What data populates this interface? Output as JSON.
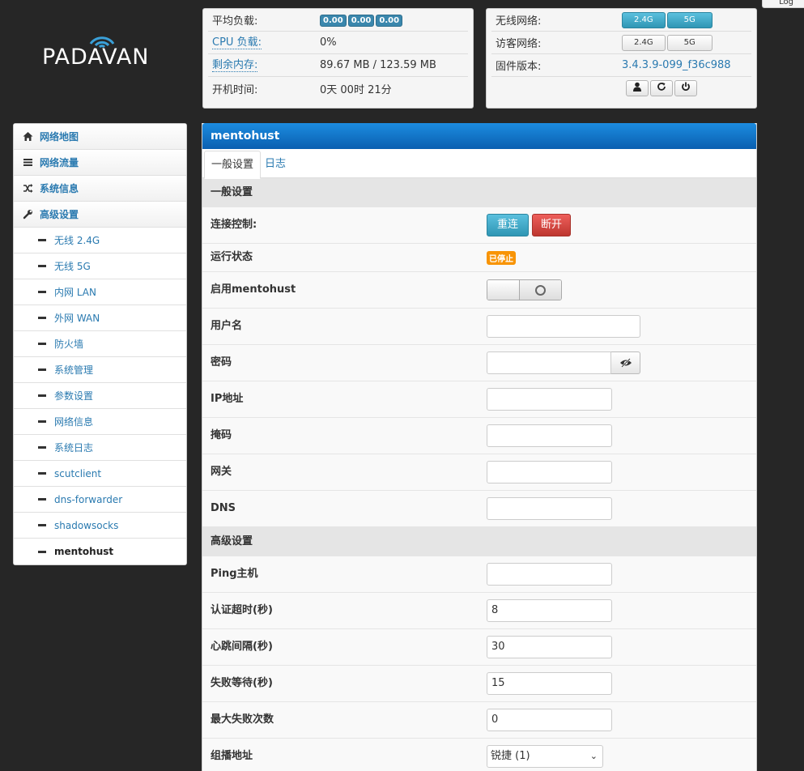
{
  "log_tab": "Log",
  "logo": {
    "text": "PADAVAN"
  },
  "status": {
    "load_label": "平均负载:",
    "load_values": [
      "0.00",
      "0.00",
      "0.00"
    ],
    "cpu_label": "CPU 负载:",
    "cpu_value": "0%",
    "mem_label": "剩余内存:",
    "mem_value": "89.67 MB / 123.59 MB",
    "uptime_label": "开机时间:",
    "uptime_value": "0天 00时 21分"
  },
  "network": {
    "wireless_label": "无线网络:",
    "guest_label": "访客网络:",
    "firmware_label": "固件版本:",
    "firmware_value": "3.4.3.9-099_f36c988",
    "band_24": "2.4G",
    "band_5": "5G"
  },
  "sidebar": {
    "items": [
      {
        "label": "网络地图",
        "icon": "home-icon"
      },
      {
        "label": "网络流量",
        "icon": "list-icon"
      },
      {
        "label": "系统信息",
        "icon": "shuffle-icon"
      },
      {
        "label": "高级设置",
        "icon": "wrench-icon"
      }
    ],
    "sub_items": [
      "无线 2.4G",
      "无线 5G",
      "内网 LAN",
      "外网 WAN",
      "防火墙",
      "系统管理",
      "参数设置",
      "网络信息",
      "系统日志",
      "scutclient",
      "dns-forwarder",
      "shadowsocks",
      "mentohust"
    ]
  },
  "main": {
    "title": "mentohust",
    "tabs": [
      "一般设置",
      "日志"
    ],
    "general_section": "一般设置",
    "advanced_section": "高级设置",
    "connect_label": "连接控制:",
    "reconnect_btn": "重连",
    "disconnect_btn": "断开",
    "status_label": "运行状态",
    "status_badge": "已停止",
    "enable_label": "启用mentohust",
    "username_label": "用户名",
    "password_label": "密码",
    "ip_label": "IP地址",
    "mask_label": "掩码",
    "gateway_label": "网关",
    "dns_label": "DNS",
    "ping_label": "Ping主机",
    "auth_timeout_label": "认证超时(秒)",
    "auth_timeout_value": "8",
    "heartbeat_label": "心跳间隔(秒)",
    "heartbeat_value": "30",
    "fail_wait_label": "失败等待(秒)",
    "fail_wait_value": "15",
    "max_fail_label": "最大失败次数",
    "max_fail_value": "0",
    "multicast_label": "组播地址",
    "multicast_value": "锐捷 (1)"
  }
}
